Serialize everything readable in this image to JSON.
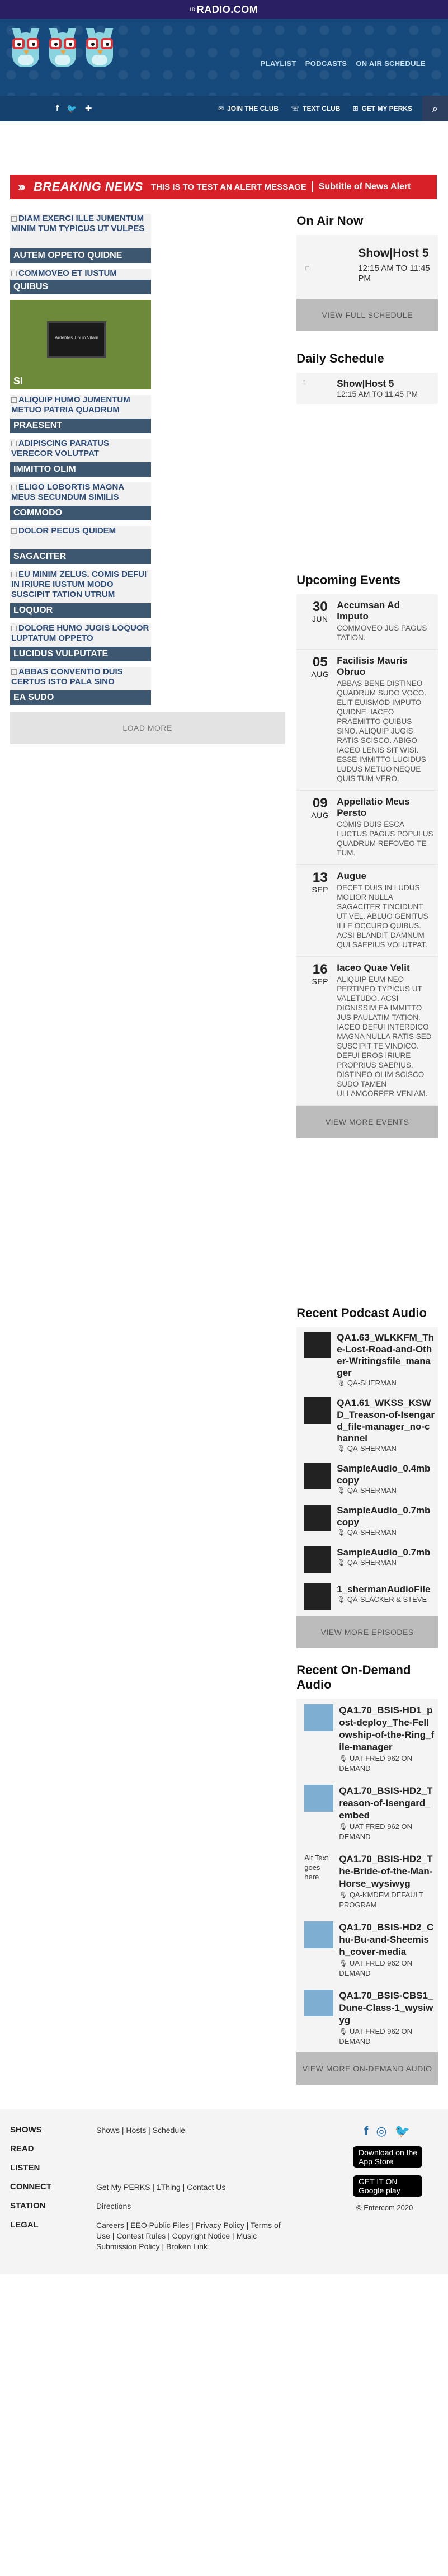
{
  "brand": {
    "prefix": "ID",
    "name": "RADIO.COM"
  },
  "nav": {
    "playlist": "PLAYLIST",
    "podcasts": "PODCASTS",
    "on_air": "ON AIR SCHEDULE"
  },
  "social": [
    "f",
    "🐦",
    "✚"
  ],
  "actions": {
    "join": "JOIN THE CLUB",
    "text": "TEXT CLUB",
    "perks": "GET MY PERKS"
  },
  "alert": {
    "label": "BREAKING NEWS",
    "message": "THIS IS TO TEST AN ALERT MESSAGE",
    "subtitle": "Subtitle of News Alert"
  },
  "cards": [
    {
      "ph": "DIAM EXERCI ILLE JUMENTUM MINIM TUM TYPICUS UT VULPES",
      "cap": "AUTEM OPPETO QUIDNE"
    },
    {
      "ph": "COMMOVEO ET IUSTUM",
      "cap": "QUIBUS"
    },
    {
      "screen": "Ardentes Tibi in Vitam",
      "cap": "SI"
    },
    {
      "ph": "ALIQUIP HUMO JUMENTUM METUO PATRIA QUADRUM",
      "cap": "PRAESENT"
    },
    {
      "ph": "ADIPISCING PARATUS VERECOR VOLUTPAT",
      "cap": "IMMITTO OLIM"
    },
    {
      "ph": "ELIGO LOBORTIS MAGNA MEUS SECUNDUM SIMILIS",
      "cap": "COMMODO"
    },
    {
      "ph": "DOLOR PECUS QUIDEM",
      "cap": "SAGACITER"
    },
    {
      "ph": "EU MINIM ZELUS. COMIS DEFUI IN IRIURE IUSTUM MODO SUSCIPIT TATION UTRUM",
      "cap": "LOQUOR"
    },
    {
      "ph": "DOLORE HUMO JUGIS LOQUOR LUPTATUM OPPETO",
      "cap": "LUCIDUS VULPUTATE"
    },
    {
      "ph": "ABBAS CONVENTIO DUIS CERTUS ISTO PALA SINO",
      "cap": "EA SUDO"
    }
  ],
  "load_more": "LOAD MORE",
  "onair": {
    "title": "On Air Now",
    "img_alt": "□",
    "host": "Show|Host 5",
    "time": "12:15 AM TO 11:45 PM",
    "btn": "VIEW FULL SCHEDULE"
  },
  "daily": {
    "title": "Daily Schedule",
    "host": "Show|Host 5",
    "time": "12:15 AM TO 11:45 PM"
  },
  "events": {
    "title": "Upcoming Events",
    "items": [
      {
        "d": "30",
        "m": "JUN",
        "t": "Accumsan Ad Imputo",
        "desc": "COMMOVEO JUS PAGUS TATION."
      },
      {
        "d": "05",
        "m": "AUG",
        "t": "Facilisis Mauris Obruo",
        "desc": "ABBAS BENE DISTINEO QUADRUM SUDO VOCO. ELIT EUISMOD IMPUTO QUIDNE. IACEO PRAEMITTO QUIBUS SINO. ALIQUIP JUGIS RATIS SCISCO. ABIGO IACEO LENIS SIT WISI. ESSE IMMITTO LUCIDUS LUDUS METUO NEQUE QUIS TUM VERO."
      },
      {
        "d": "09",
        "m": "AUG",
        "t": "Appellatio Meus Persto",
        "desc": "COMIS DUIS ESCA LUCTUS PAGUS POPULUS QUADRUM REFOVEO TE TUM."
      },
      {
        "d": "13",
        "m": "SEP",
        "t": "Augue",
        "desc": "DECET DUIS IN LUDUS MOLIOR NULLA SAGACITER TINCIDUNT UT VEL. ABLUO GENITUS ILLE OCCURO QUIBUS. ACSI BLANDIT DAMNUM QUI SAEPIUS VOLUTPAT."
      },
      {
        "d": "16",
        "m": "SEP",
        "t": "Iaceo Quae Velit",
        "desc": "ALIQUIP EUM NEO PERTINEO TYPICUS UT VALETUDO. ACSI DIGNISSIM EA IMMITTO JUS PAULATIM TATION. IACEO DEFUI INTERDICO MAGNA NULLA RATIS SED SUSCIPIT TE VINDICO. DEFUI EROS IRIURE PROPRIUS SAEPIUS. DISTINEO OLIM SCISCO SUDO TAMEN ULLAMCORPER VENIAM."
      }
    ],
    "btn": "VIEW MORE EVENTS"
  },
  "podcasts": {
    "title": "Recent Podcast Audio",
    "items": [
      {
        "t": "QA1.63_WLKKFM_The-Lost-Road-and-Other-Writingsfile_manager",
        "s": "QA-SHERMAN"
      },
      {
        "t": "QA1.61_WKSS_KSWD_Treason-of-Isengard_file-manager_no-channel",
        "s": "QA-SHERMAN"
      },
      {
        "t": "SampleAudio_0.4mb copy",
        "s": "QA-SHERMAN"
      },
      {
        "t": "SampleAudio_0.7mb copy",
        "s": "QA-SHERMAN"
      },
      {
        "t": "SampleAudio_0.7mb",
        "s": "QA-SHERMAN"
      },
      {
        "t": "1_shermanAudioFile",
        "s": "QA-SLACKER & STEVE"
      }
    ],
    "btn": "VIEW MORE EPISODES"
  },
  "ondemand": {
    "title": "Recent On-Demand Audio",
    "items": [
      {
        "t": "QA1.70_BSIS-HD1_post-deploy_The-Fellowship-of-the-Ring_file-manager",
        "s": "UAT FRED 962 ON DEMAND"
      },
      {
        "t": "QA1.70_BSIS-HD2_Treason-of-Isengard_embed",
        "s": "UAT FRED 962 ON DEMAND"
      },
      {
        "alt": "Alt Text goes here",
        "t": "QA1.70_BSIS-HD2_The-Bride-of-the-Man-Horse_wysiwyg",
        "s": "QA-KMDFM DEFAULT PROGRAM"
      },
      {
        "t": "QA1.70_BSIS-HD2_Chu-Bu-and-Sheemish_cover-media",
        "s": "UAT FRED 962 ON DEMAND"
      },
      {
        "t": "QA1.70_BSIS-CBS1_Dune-Class-1_wysiwyg",
        "s": "UAT FRED 962 ON DEMAND"
      }
    ],
    "btn": "VIEW MORE ON-DEMAND AUDIO"
  },
  "footer": {
    "rows": [
      {
        "k": "SHOWS",
        "v": "Shows | Hosts | Schedule"
      },
      {
        "k": "READ",
        "v": ""
      },
      {
        "k": "LISTEN",
        "v": ""
      },
      {
        "k": "CONNECT",
        "v": "Get My PERKS | 1Thing | Contact Us"
      },
      {
        "k": "STATION",
        "v": "Directions"
      },
      {
        "k": "LEGAL",
        "v": "Careers | EEO Public Files | Privacy Policy | Terms of Use | Contest Rules | Copyright Notice | Music Submission Policy | Broken Link"
      }
    ],
    "appstore": "Download on the App Store",
    "googleplay": "GET IT ON Google play",
    "copyright": "© Entercom 2020"
  }
}
